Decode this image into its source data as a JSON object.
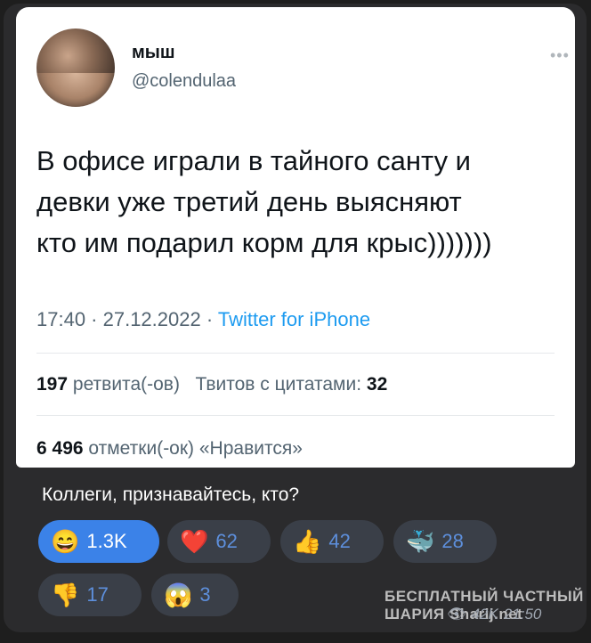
{
  "tweet": {
    "author_name": "мыш",
    "author_handle": "@colendulaa",
    "more_icon": "ellipsis-icon",
    "text_lines": [
      "В офисе играли в тайного санту и",
      "девки уже третий день выясняют",
      "кто им подарил корм для крыс)))))))"
    ],
    "time": "17:40 · 27.12.2022 · ",
    "source": "Twitter for iPhone",
    "retweets_count": "197",
    "retweets_label": "ретвита(-ов)",
    "quotes_label": "Твитов с цитатами:",
    "quotes_count": "32",
    "likes_count": "6 496",
    "likes_label": "отметки(-ок) «Нравится»"
  },
  "message": {
    "caption": "Коллеги, признавайтесь, кто?",
    "reactions": [
      {
        "emoji": "😄",
        "count": "1.3K",
        "active": true
      },
      {
        "emoji": "❤️",
        "count": "62",
        "active": false
      },
      {
        "emoji": "👍",
        "count": "42",
        "active": false
      },
      {
        "emoji": "🐳",
        "count": "28",
        "active": false
      },
      {
        "emoji": "👎",
        "count": "17",
        "active": false
      },
      {
        "emoji": "😱",
        "count": "3",
        "active": false
      }
    ],
    "views": "42K",
    "time": "21:50",
    "watermark_line1": "БЕСПЛАТНЫЙ ЧАСТНЫЙ",
    "watermark_line2": "ШАРИЯ Sharij.net"
  },
  "colors": {
    "accent": "#3b82e8",
    "link": "#1d9bf0",
    "bubble_bg": "#2b2b2d"
  }
}
